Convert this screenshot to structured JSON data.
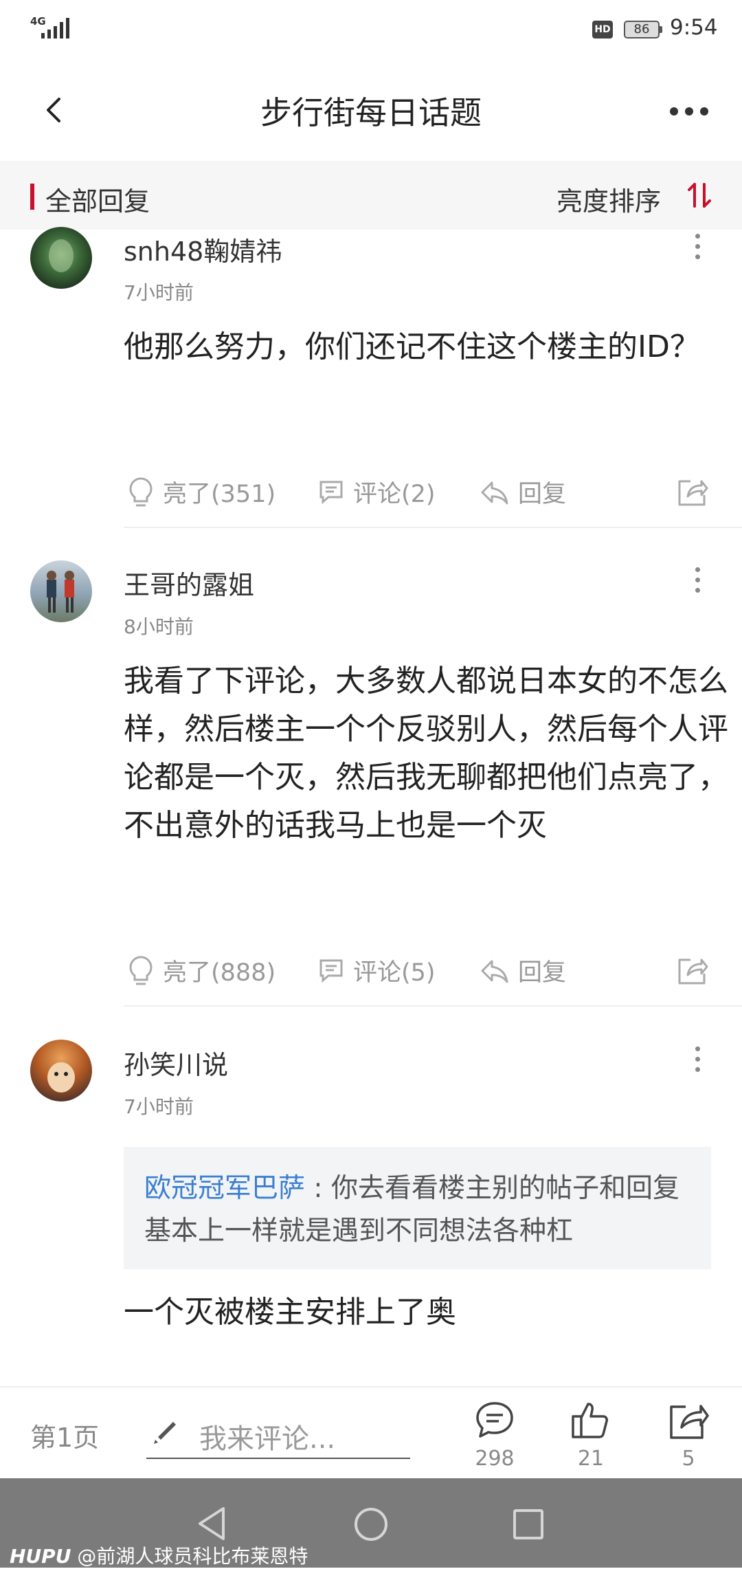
{
  "status": {
    "network": "4G",
    "hd": "HD",
    "battery": "86",
    "time": "9:54"
  },
  "header": {
    "title": "步行街每日话题"
  },
  "filter": {
    "label": "全部回复",
    "sort": "亮度排序"
  },
  "comments": [
    {
      "user": "snh48鞠婧祎",
      "time": "7小时前",
      "text": "他那么努力，你们还记不住这个楼主的ID？",
      "likes": "亮了(351)",
      "replies": "评论(2)",
      "reply": "回复"
    },
    {
      "user": "王哥的露姐",
      "time": "8小时前",
      "text": "我看了下评论，大多数人都说日本女的不怎么样，然后楼主一个个反驳别人，然后每个人评论都是一个灭，然后我无聊都把他们点亮了，不出意外的话我马上也是一个灭",
      "likes": "亮了(888)",
      "replies": "评论(5)",
      "reply": "回复"
    },
    {
      "user": "孙笑川说",
      "time": "7小时前",
      "quote_author": "欧冠冠军巴萨",
      "quote_sep": " : ",
      "quote_text": "你去看看楼主别的帖子和回复 基本上一样就是遇到不同想法各种杠",
      "text": "一个灭被楼主安排上了奥"
    }
  ],
  "bottom": {
    "page": "第1页",
    "placeholder": "我来评论...",
    "comments_count": "298",
    "likes_count": "21",
    "shares_count": "5"
  },
  "watermark": {
    "brand": "HUPU",
    "text": "@前湖人球员科比布莱恩特"
  },
  "colors": {
    "accent": "#c8102e",
    "link": "#3b7fd1",
    "nav": "#7b7b7b"
  }
}
